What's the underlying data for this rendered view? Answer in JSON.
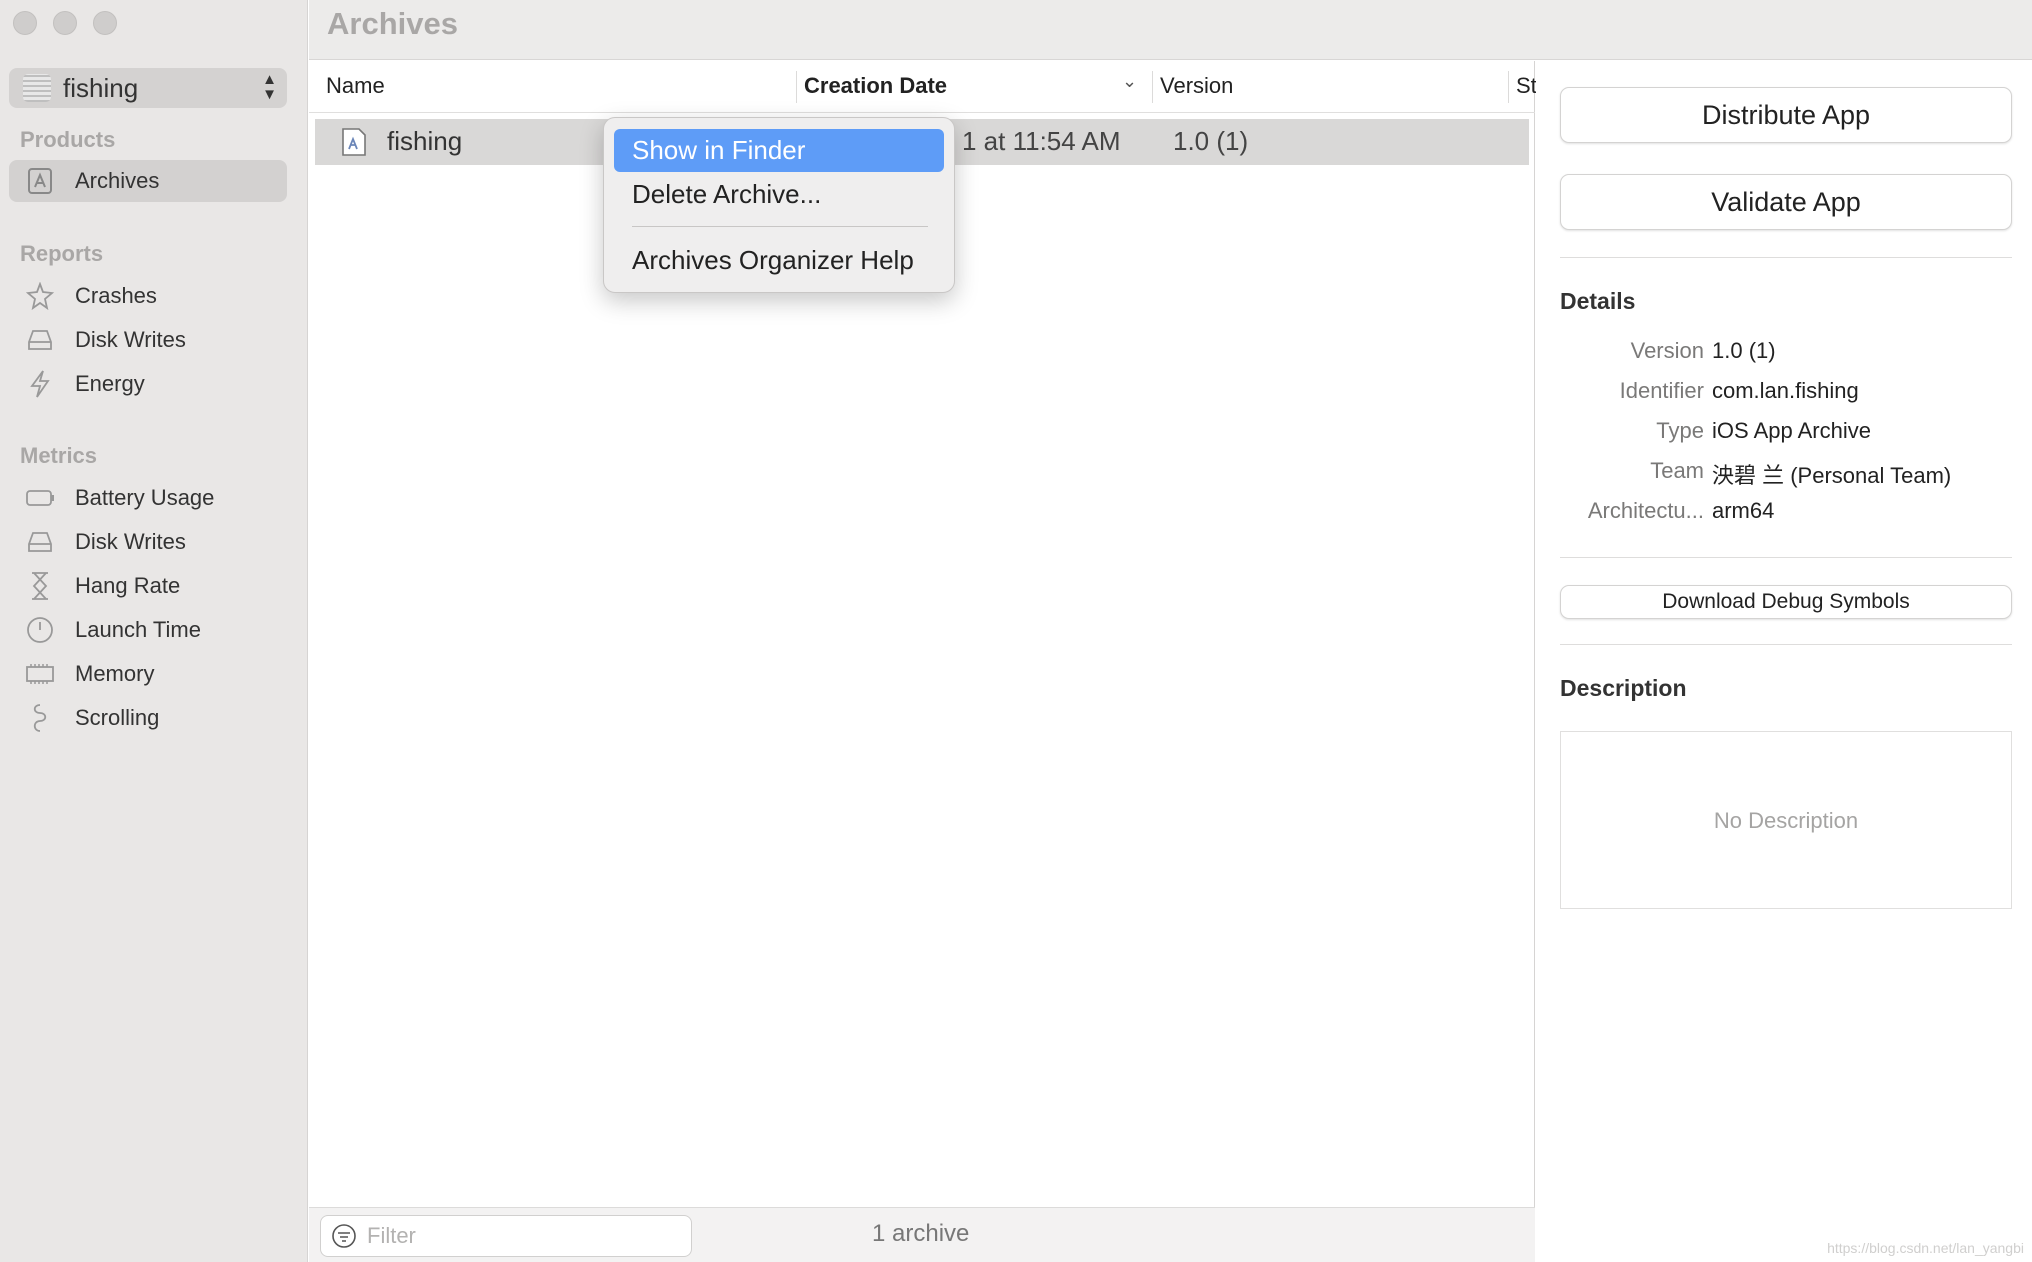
{
  "window": {
    "title": "Archives"
  },
  "sidebar": {
    "scheme": "fishing",
    "products_title": "Products",
    "products": [
      {
        "label": "Archives",
        "icon": "archive-icon"
      }
    ],
    "reports_title": "Reports",
    "reports": [
      {
        "label": "Crashes",
        "icon": "crash-icon"
      },
      {
        "label": "Disk Writes",
        "icon": "disk-icon"
      },
      {
        "label": "Energy",
        "icon": "bolt-icon"
      }
    ],
    "metrics_title": "Metrics",
    "metrics": [
      {
        "label": "Battery Usage",
        "icon": "battery-icon"
      },
      {
        "label": "Disk Writes",
        "icon": "disk-icon"
      },
      {
        "label": "Hang Rate",
        "icon": "hourglass-icon"
      },
      {
        "label": "Launch Time",
        "icon": "clock-icon"
      },
      {
        "label": "Memory",
        "icon": "memory-icon"
      },
      {
        "label": "Scrolling",
        "icon": "scroll-icon"
      }
    ]
  },
  "table": {
    "columns": [
      "Name",
      "Creation Date",
      "Version",
      "St"
    ],
    "rows": [
      {
        "name": "fishing",
        "date": "1 at 11:54 AM",
        "version": "1.0 (1)"
      }
    ]
  },
  "context_menu": {
    "items": [
      "Show in Finder",
      "Delete Archive...",
      "Archives Organizer Help"
    ]
  },
  "bottom": {
    "filter_placeholder": "Filter",
    "count": "1 archive"
  },
  "inspector": {
    "distribute": "Distribute App",
    "validate": "Validate App",
    "details_title": "Details",
    "details": [
      {
        "key": "Version",
        "value": "1.0 (1)"
      },
      {
        "key": "Identifier",
        "value": "com.lan.fishing"
      },
      {
        "key": "Type",
        "value": "iOS App Archive"
      },
      {
        "key": "Team",
        "value": "泱碧 兰 (Personal Team)"
      },
      {
        "key": "Architectu...",
        "value": "arm64"
      }
    ],
    "download": "Download Debug Symbols",
    "description_title": "Description",
    "description": "No Description"
  },
  "watermark": "https://blog.csdn.net/lan_yangbi",
  "colors": {
    "menu_highlight": "#5e9cf7",
    "sidebar_bg": "#e9e7e6",
    "selection": "#d3d1d0"
  }
}
